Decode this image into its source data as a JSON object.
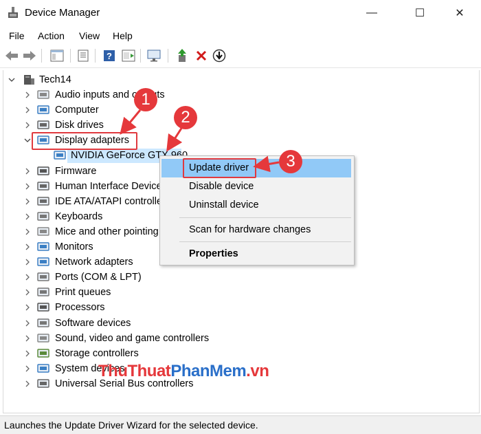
{
  "window": {
    "title": "Device Manager",
    "minimize": "—",
    "maximize": "☐",
    "close": "✕"
  },
  "menu": [
    "File",
    "Action",
    "View",
    "Help"
  ],
  "tree": {
    "root": "Tech14",
    "categories": [
      {
        "label": "Audio inputs and outputs",
        "icon": "speaker-icon",
        "expanded": false
      },
      {
        "label": "Computer",
        "icon": "monitor-icon",
        "expanded": false
      },
      {
        "label": "Disk drives",
        "icon": "disk-icon",
        "expanded": false
      },
      {
        "label": "Display adapters",
        "icon": "display-adapter-icon",
        "expanded": true,
        "children": [
          "NVIDIA GeForce GTX 960"
        ]
      },
      {
        "label": "Firmware",
        "icon": "chip-icon",
        "expanded": false
      },
      {
        "label": "Human Interface Devices",
        "icon": "hid-icon",
        "expanded": false
      },
      {
        "label": "IDE ATA/ATAPI controllers",
        "icon": "controller-icon",
        "expanded": false
      },
      {
        "label": "Keyboards",
        "icon": "keyboard-icon",
        "expanded": false
      },
      {
        "label": "Mice and other pointing devices",
        "icon": "mouse-icon",
        "expanded": false
      },
      {
        "label": "Monitors",
        "icon": "monitor-icon",
        "expanded": false
      },
      {
        "label": "Network adapters",
        "icon": "network-icon",
        "expanded": false
      },
      {
        "label": "Ports (COM & LPT)",
        "icon": "port-icon",
        "expanded": false
      },
      {
        "label": "Print queues",
        "icon": "printer-icon",
        "expanded": false
      },
      {
        "label": "Processors",
        "icon": "cpu-icon",
        "expanded": false
      },
      {
        "label": "Software devices",
        "icon": "software-icon",
        "expanded": false
      },
      {
        "label": "Sound, video and game controllers",
        "icon": "speaker-icon",
        "expanded": false
      },
      {
        "label": "Storage controllers",
        "icon": "storage-icon",
        "expanded": false
      },
      {
        "label": "System devices",
        "icon": "system-icon",
        "expanded": false
      },
      {
        "label": "Universal Serial Bus controllers",
        "icon": "usb-icon",
        "expanded": false
      }
    ]
  },
  "context_menu": {
    "items": [
      "Update driver",
      "Disable device",
      "Uninstall device",
      "Scan for hardware changes",
      "Properties"
    ]
  },
  "annotations": {
    "step1": "1",
    "step2": "2",
    "step3": "3",
    "color": "#e5383b"
  },
  "watermark": {
    "part1": "ThuThuat",
    "part2": "PhanMem",
    "part3": ".vn"
  },
  "status": "Launches the Update Driver Wizard for the selected device."
}
